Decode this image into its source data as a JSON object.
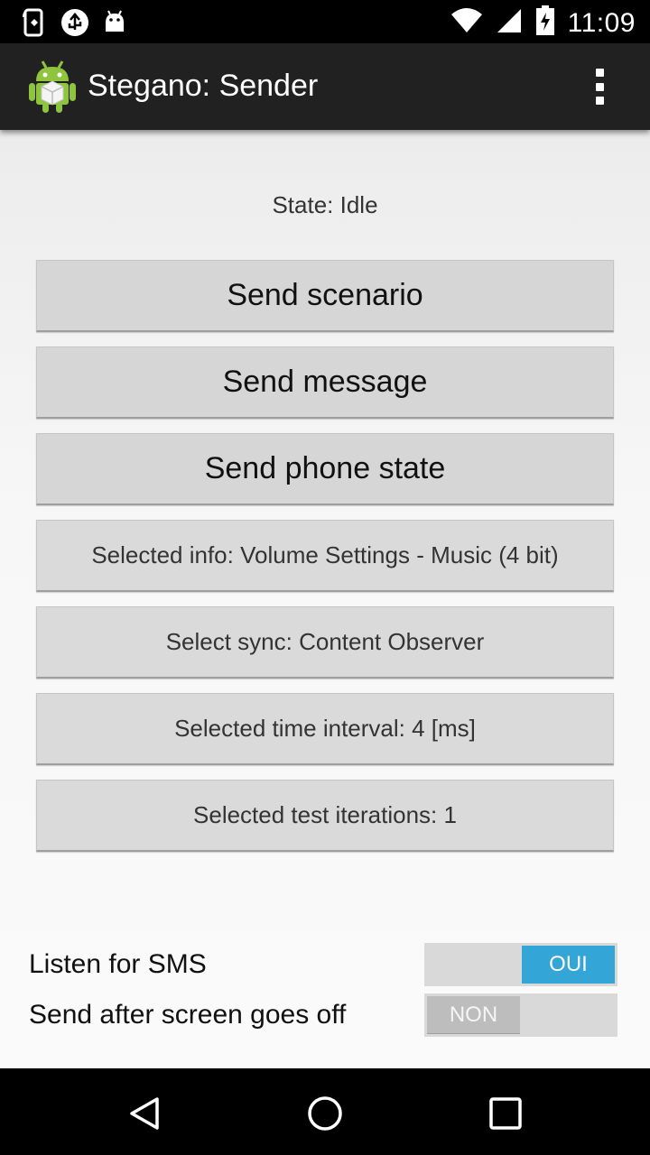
{
  "status_bar": {
    "time": "11:09",
    "left_icons": [
      "screenshot-icon",
      "usb-debug-icon",
      "android-debug-icon"
    ],
    "right_icons": [
      "wifi-icon",
      "cell-signal-icon",
      "battery-charging-icon"
    ]
  },
  "action_bar": {
    "title": "Stegano: Sender",
    "app_icon": "android-box-icon",
    "menu_icon": "overflow-menu-icon"
  },
  "state": {
    "label": "State: Idle"
  },
  "buttons": {
    "send_scenario": "Send scenario",
    "send_message": "Send message",
    "send_phone_state": "Send phone state",
    "selected_info": "Selected info: Volume Settings - Music (4 bit)",
    "select_sync": "Select sync: Content Observer",
    "selected_time_interval": "Selected time interval: 4 [ms]",
    "selected_test_iterations": "Selected test iterations: 1"
  },
  "settings": {
    "listen_sms": {
      "label": "Listen for SMS",
      "toggle_text": "OUI",
      "checked": true
    },
    "send_after_screen_off": {
      "label": "Send after screen goes off",
      "toggle_text": "NON",
      "checked": false
    }
  },
  "colors": {
    "accent": "#33a5d6",
    "action_bar": "#212121",
    "button": "#d6d6d6"
  },
  "nav_bar": {
    "back_icon": "back-triangle-icon",
    "home_icon": "home-circle-icon",
    "recents_icon": "recents-square-icon"
  }
}
